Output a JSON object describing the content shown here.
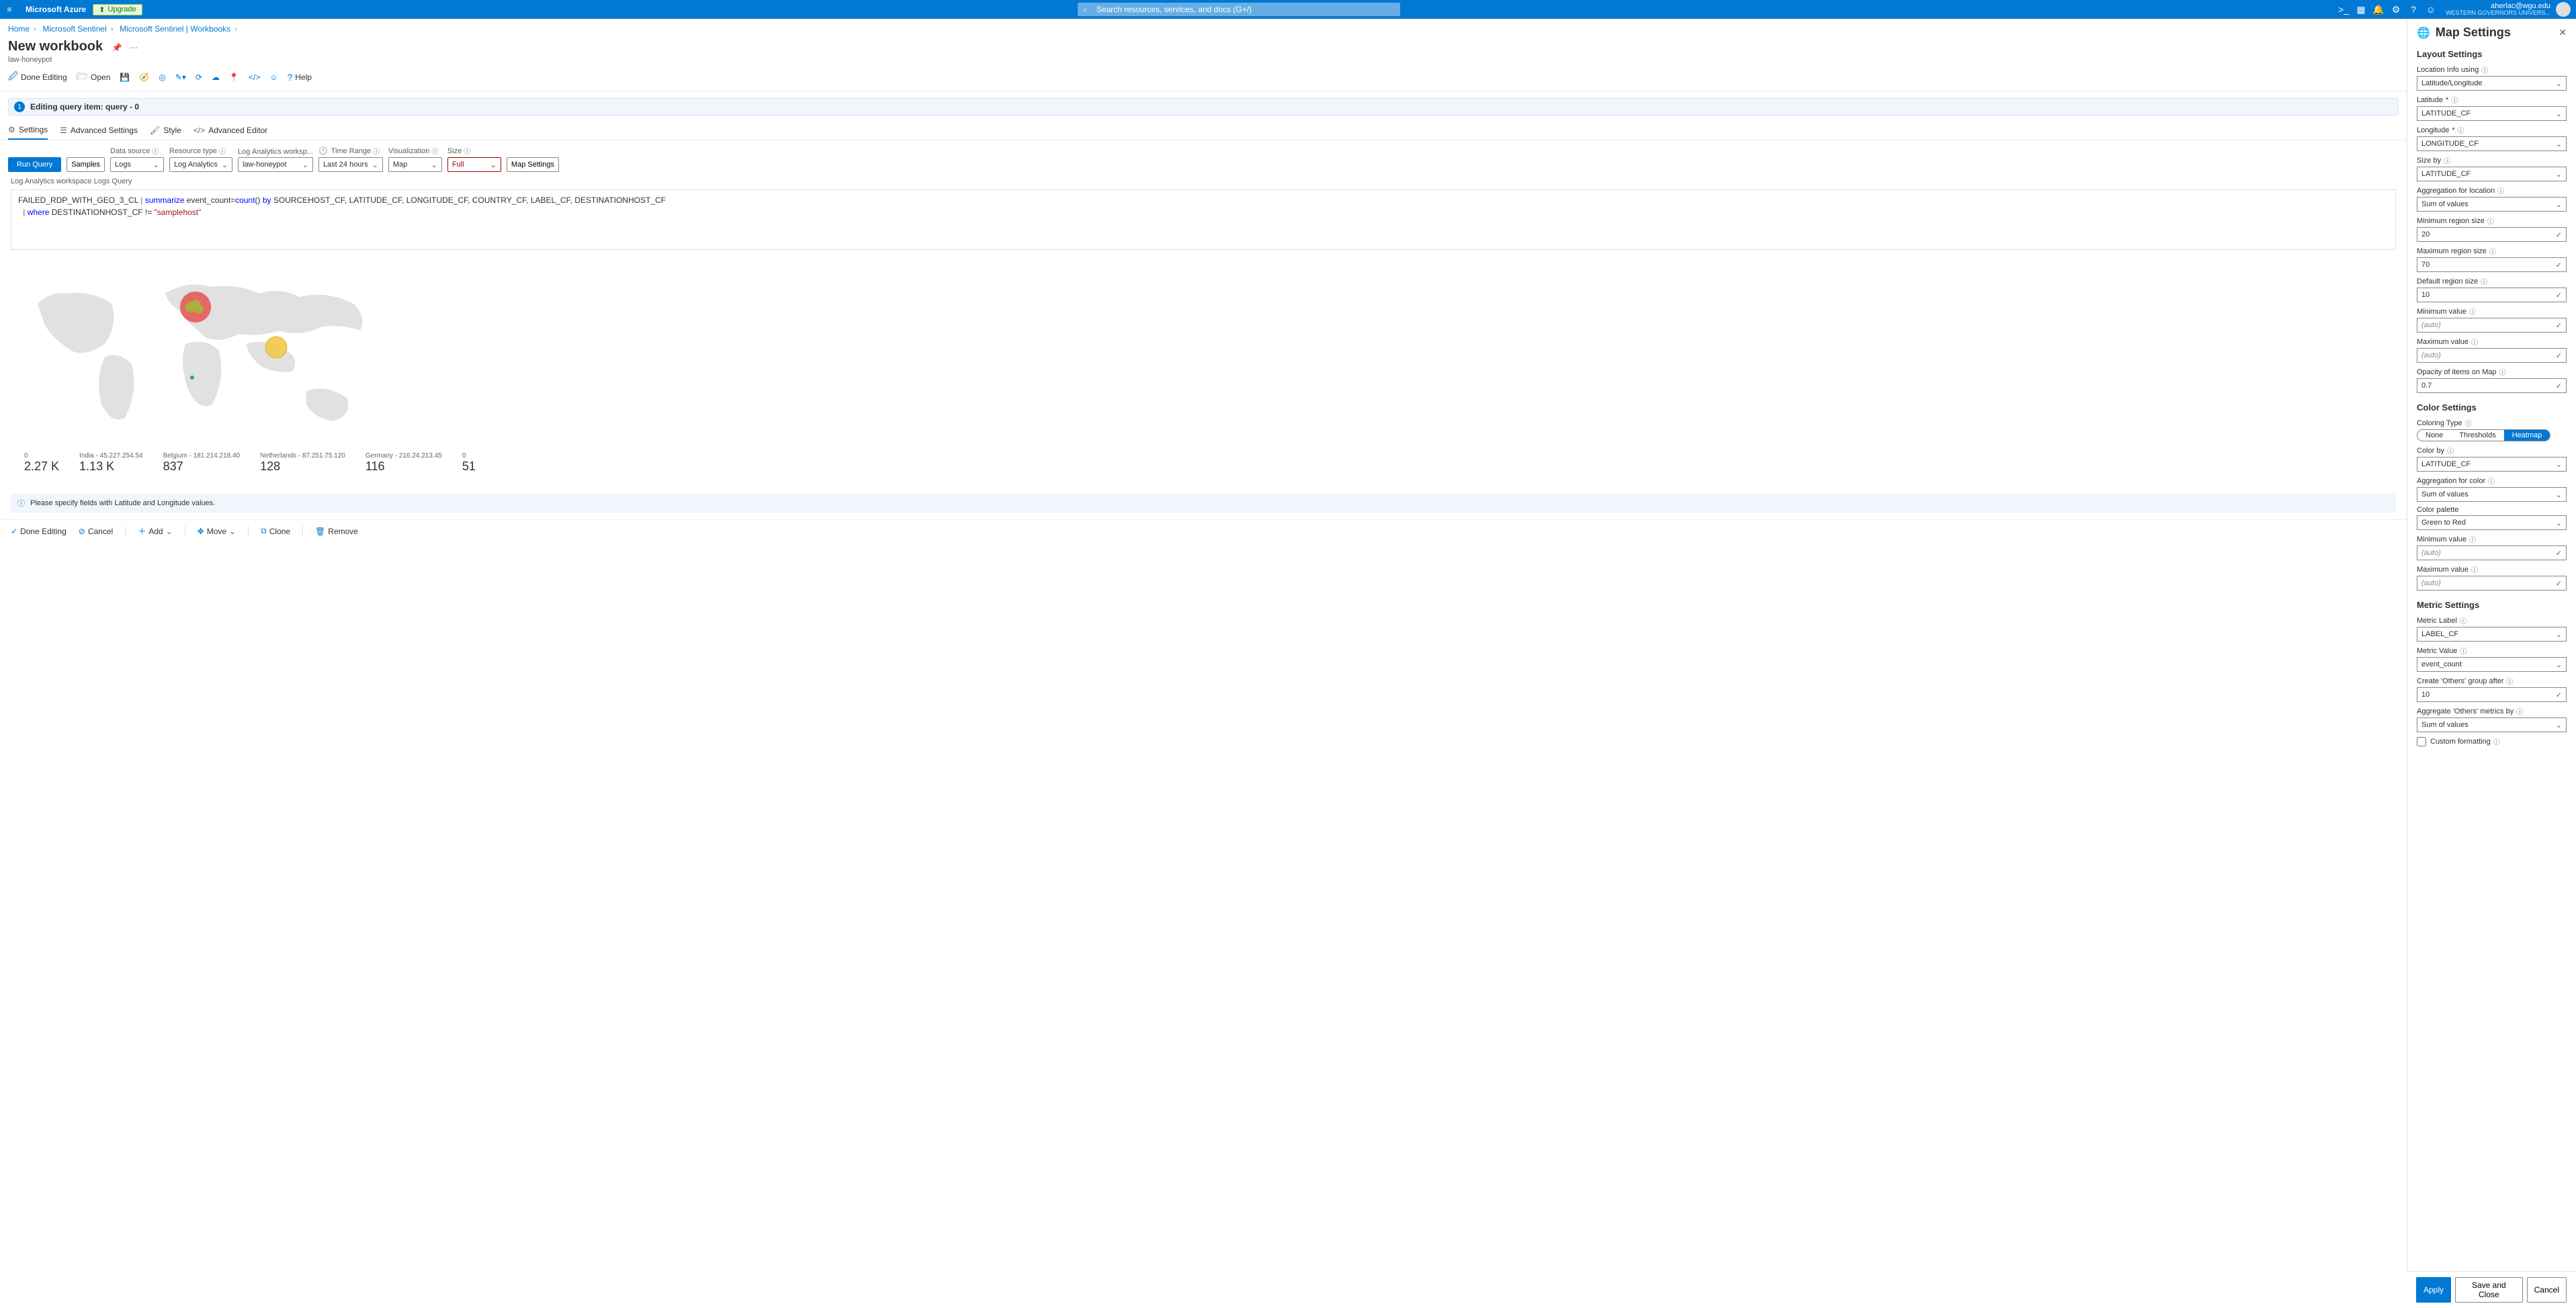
{
  "topbar": {
    "brand": "Microsoft Azure",
    "upgrade": "Upgrade",
    "search_placeholder": "Search resources, services, and docs (G+/)",
    "email": "aherlac@wgu.edu",
    "org": "WESTERN GOVERNORS UNIVERS..."
  },
  "breadcrumb": {
    "items": [
      "Home",
      "Microsoft Sentinel",
      "Microsoft Sentinel | Workbooks"
    ]
  },
  "page": {
    "title": "New workbook",
    "subtitle": "law-honeypot"
  },
  "toolbar": {
    "done": "Done Editing",
    "open": "Open",
    "help": "Help"
  },
  "editing_banner": "Editing query item: query - 0",
  "edit_tabs": {
    "settings": "Settings",
    "advanced": "Advanced Settings",
    "style": "Style",
    "editor": "Advanced Editor"
  },
  "query": {
    "run": "Run Query",
    "samples": "Samples",
    "datasource_label": "Data source",
    "datasource_value": "Logs",
    "restype_label": "Resource type",
    "restype_value": "Log Analytics",
    "workspace_label": "Log Analytics worksp...",
    "workspace_value": "law-honeypot",
    "timerange_label": "Time Range",
    "timerange_value": "Last 24 hours",
    "visualization_label": "Visualization",
    "visualization_value": "Map",
    "size_label": "Size",
    "size_value": "Full",
    "mapsettings": "Map Settings"
  },
  "editor_label": "Log Analytics workspace Logs Query",
  "code": {
    "l1a": "FAILED_RDP_WITH_GEO_3_CL ",
    "l1b": "summarize",
    "l1c": " event_count=",
    "l1d": "count",
    "l1e": "() ",
    "l1f": "by",
    "l1g": " SOURCEHOST_CF, LATITUDE_CF, LONGITUDE_CF, COUNTRY_CF, LABEL_CF, DESTINATIONHOST_CF",
    "l2a": "where",
    "l2b": " DESTINATIONHOST_CF != ",
    "l2c": "\"samplehost\""
  },
  "stats": [
    {
      "label": "0",
      "value": "2.27 K"
    },
    {
      "label": "India - 45.227.254.54",
      "value": "1.13 K"
    },
    {
      "label": "Belgium - 181.214.218.40",
      "value": "837"
    },
    {
      "label": "Netherlands - 87.251.75.120",
      "value": "128"
    },
    {
      "label": "Germany - 216.24.213.45",
      "value": "116"
    },
    {
      "label": "0",
      "value": "51"
    }
  ],
  "info_msg": "Please specify fields with Latitude and Longitude values.",
  "bottom": {
    "done": "Done Editing",
    "cancel": "Cancel",
    "add": "Add",
    "move": "Move",
    "clone": "Clone",
    "remove": "Remove"
  },
  "panel": {
    "title": "Map Settings",
    "layout_h": "Layout Settings",
    "loc_info": "Location Info using",
    "loc_info_val": "Latitude/Longitude",
    "lat": "Latitude",
    "lat_val": "LATITUDE_CF",
    "lon": "Longitude",
    "lon_val": "LONGITUDE_CF",
    "size_by": "Size by",
    "size_by_val": "LATITUDE_CF",
    "agg_loc": "Aggregation for location",
    "agg_loc_val": "Sum of values",
    "min_reg": "Minimum region size",
    "min_reg_val": "20",
    "max_reg": "Maximum region size",
    "max_reg_val": "70",
    "def_reg": "Default region size",
    "def_reg_val": "10",
    "min_val": "Minimum value",
    "min_val_val": "(auto)",
    "max_val": "Maximum value",
    "max_val_val": "(auto)",
    "opacity": "Opacity of items on Map",
    "opacity_val": "0.7",
    "color_h": "Color Settings",
    "color_type": "Coloring Type",
    "pills": [
      "None",
      "Thresholds",
      "Heatmap"
    ],
    "color_by": "Color by",
    "color_by_val": "LATITUDE_CF",
    "agg_color": "Aggregation for color",
    "agg_color_val": "Sum of values",
    "palette": "Color palette",
    "palette_val": "Green to Red",
    "cmin": "Minimum value",
    "cmin_val": "(auto)",
    "cmax": "Maximum value",
    "cmax_val": "(auto)",
    "metric_h": "Metric Settings",
    "mlabel": "Metric Label",
    "mlabel_val": "LABEL_CF",
    "mvalue": "Metric Value",
    "mvalue_val": "event_count",
    "others_after": "Create 'Others' group after",
    "others_after_val": "10",
    "agg_others": "Aggregate 'Others' metrics by",
    "agg_others_val": "Sum of values",
    "custom_fmt": "Custom formatting",
    "apply": "Apply",
    "save_close": "Save and Close",
    "cancel": "Cancel"
  }
}
